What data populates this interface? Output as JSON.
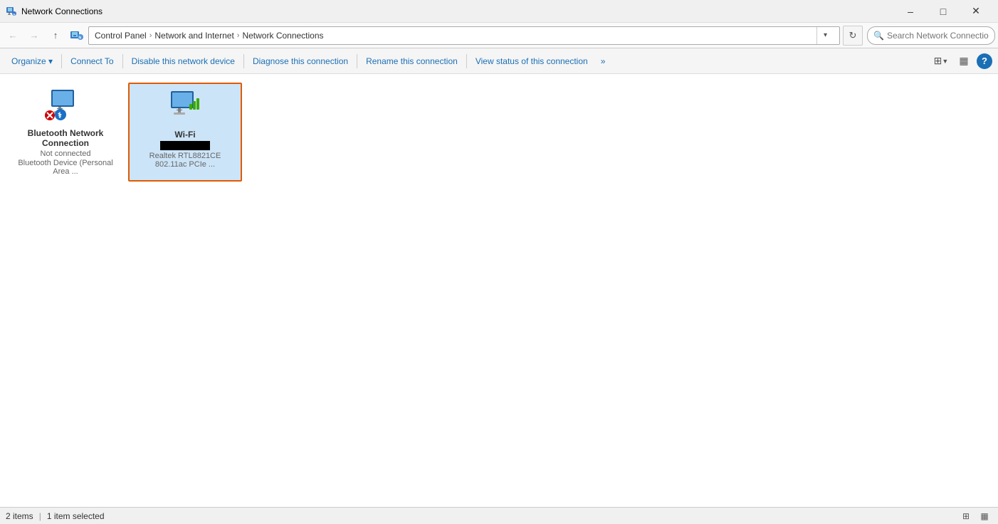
{
  "titleBar": {
    "icon": "network-connections-icon",
    "title": "Network Connections",
    "minimizeLabel": "–",
    "maximizeLabel": "□",
    "closeLabel": "✕"
  },
  "addressBar": {
    "backLabel": "←",
    "forwardLabel": "→",
    "upLabel": "↑",
    "breadcrumbs": [
      "Control Panel",
      "Network and Internet",
      "Network Connections"
    ],
    "dropdownLabel": "▾",
    "refreshLabel": "↻",
    "searchPlaceholder": "Search Network Connections"
  },
  "toolbar": {
    "organizeLabel": "Organize ▾",
    "connectToLabel": "Connect To",
    "disableLabel": "Disable this network device",
    "diagnoseLabel": "Diagnose this connection",
    "renameLabel": "Rename this connection",
    "viewStatusLabel": "View status of this connection",
    "moreLabel": "»",
    "viewIconLabel": "⊞",
    "viewDropLabel": "▾",
    "previewLabel": "□",
    "helpLabel": "?"
  },
  "networkItems": [
    {
      "id": "bluetooth",
      "name": "Bluetooth Network Connection",
      "status": "Not connected",
      "detail": "Bluetooth Device (Personal Area ...",
      "selected": false,
      "hasError": true,
      "isWifi": false
    },
    {
      "id": "wifi",
      "name": "Wi-Fi",
      "statusRedacted": true,
      "detail": "Realtek RTL8821CE 802.11ac PCIe ...",
      "selected": true,
      "hasError": false,
      "isWifi": true
    }
  ],
  "statusBar": {
    "itemCount": "2 items",
    "selected": "1 item selected"
  }
}
